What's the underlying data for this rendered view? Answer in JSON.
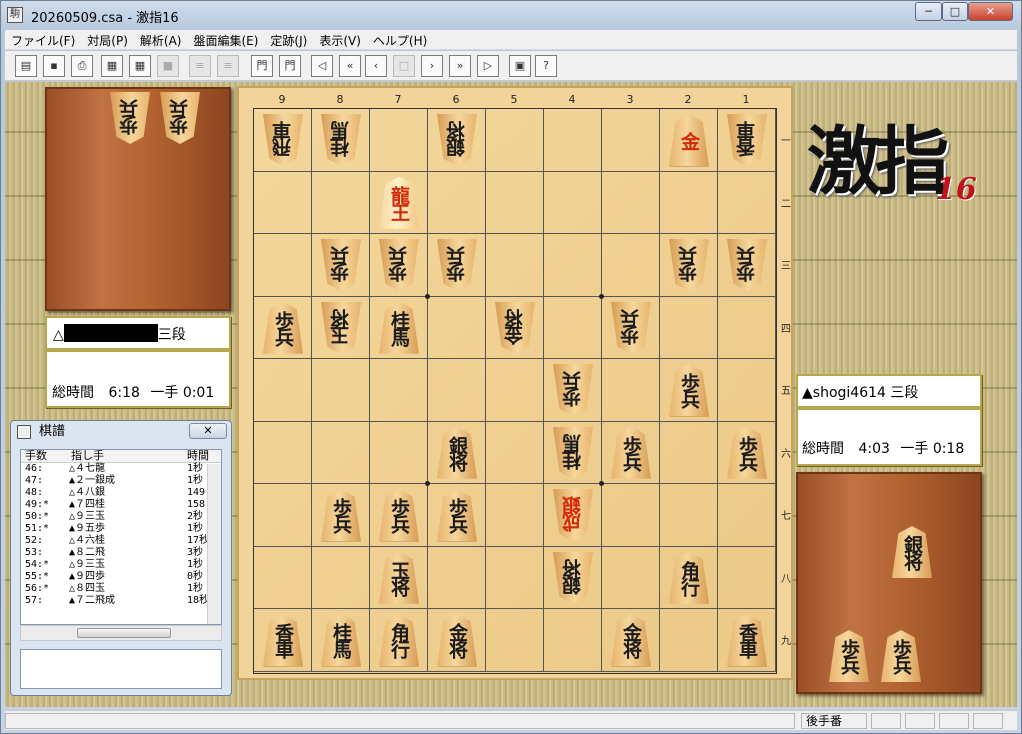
{
  "window": {
    "title": "20260509.csa - 激指16",
    "minimize": "─",
    "maximize": "□",
    "close": "✕"
  },
  "menu": [
    "ファイル(F)",
    "対局(P)",
    "解析(A)",
    "盤面編集(E)",
    "定跡(J)",
    "表示(V)",
    "ヘルプ(H)"
  ],
  "toolbar": [
    {
      "name": "new-icon",
      "glyph": "▤",
      "enabled": true
    },
    {
      "name": "save-icon",
      "glyph": "▪",
      "enabled": true
    },
    {
      "name": "print-icon",
      "glyph": "⎙",
      "enabled": true
    },
    {
      "name": "book-icon",
      "glyph": "▦",
      "enabled": true
    },
    {
      "name": "book2-icon",
      "glyph": "▦",
      "enabled": true
    },
    {
      "name": "blank-icon",
      "glyph": "■",
      "enabled": false
    },
    {
      "name": "list-icon",
      "glyph": "≡",
      "enabled": false
    },
    {
      "name": "list2-icon",
      "glyph": "≡",
      "enabled": false
    },
    {
      "name": "board-icon",
      "glyph": "門",
      "enabled": true
    },
    {
      "name": "board2-icon",
      "glyph": "門",
      "enabled": true
    },
    {
      "name": "first-move-icon",
      "glyph": "◁",
      "enabled": true
    },
    {
      "name": "back10-icon",
      "glyph": "«",
      "enabled": true
    },
    {
      "name": "back-icon",
      "glyph": "‹",
      "enabled": true
    },
    {
      "name": "stop-icon",
      "glyph": "□",
      "enabled": false
    },
    {
      "name": "forward-icon",
      "glyph": "›",
      "enabled": true
    },
    {
      "name": "forward10-icon",
      "glyph": "»",
      "enabled": true
    },
    {
      "name": "last-move-icon",
      "glyph": "▷",
      "enabled": true
    },
    {
      "name": "monitor-icon",
      "glyph": "▣",
      "enabled": true
    },
    {
      "name": "help-icon",
      "glyph": "?",
      "enabled": true
    }
  ],
  "board": {
    "files": [
      "9",
      "8",
      "7",
      "6",
      "5",
      "4",
      "3",
      "2",
      "1"
    ],
    "ranks": [
      "一",
      "二",
      "三",
      "四",
      "五",
      "六",
      "七",
      "八",
      "九"
    ],
    "pieces": [
      {
        "file": 9,
        "rank": 1,
        "label": "飛車",
        "side": "gote"
      },
      {
        "file": 8,
        "rank": 1,
        "label": "桂馬",
        "side": "gote"
      },
      {
        "file": 6,
        "rank": 1,
        "label": "銀将",
        "side": "gote"
      },
      {
        "file": 2,
        "rank": 1,
        "label": "金",
        "side": "sente",
        "promoted": true
      },
      {
        "file": 1,
        "rank": 1,
        "label": "香車",
        "side": "gote"
      },
      {
        "file": 7,
        "rank": 2,
        "label": "龍王",
        "side": "sente",
        "promoted": true,
        "last": true
      },
      {
        "file": 8,
        "rank": 3,
        "label": "歩兵",
        "side": "gote"
      },
      {
        "file": 7,
        "rank": 3,
        "label": "歩兵",
        "side": "gote"
      },
      {
        "file": 6,
        "rank": 3,
        "label": "歩兵",
        "side": "gote"
      },
      {
        "file": 2,
        "rank": 3,
        "label": "歩兵",
        "side": "gote"
      },
      {
        "file": 1,
        "rank": 3,
        "label": "歩兵",
        "side": "gote"
      },
      {
        "file": 9,
        "rank": 4,
        "label": "歩兵",
        "side": "sente"
      },
      {
        "file": 8,
        "rank": 4,
        "label": "玉将",
        "side": "gote"
      },
      {
        "file": 7,
        "rank": 4,
        "label": "桂馬",
        "side": "sente"
      },
      {
        "file": 5,
        "rank": 4,
        "label": "金将",
        "side": "gote"
      },
      {
        "file": 3,
        "rank": 4,
        "label": "歩兵",
        "side": "gote"
      },
      {
        "file": 4,
        "rank": 5,
        "label": "歩兵",
        "side": "gote"
      },
      {
        "file": 2,
        "rank": 5,
        "label": "歩兵",
        "side": "sente"
      },
      {
        "file": 6,
        "rank": 6,
        "label": "銀将",
        "side": "sente"
      },
      {
        "file": 4,
        "rank": 6,
        "label": "桂馬",
        "side": "gote"
      },
      {
        "file": 3,
        "rank": 6,
        "label": "歩兵",
        "side": "sente"
      },
      {
        "file": 1,
        "rank": 6,
        "label": "歩兵",
        "side": "sente"
      },
      {
        "file": 8,
        "rank": 7,
        "label": "歩兵",
        "side": "sente"
      },
      {
        "file": 7,
        "rank": 7,
        "label": "歩兵",
        "side": "sente"
      },
      {
        "file": 6,
        "rank": 7,
        "label": "歩兵",
        "side": "sente"
      },
      {
        "file": 4,
        "rank": 7,
        "label": "成銀",
        "side": "gote",
        "promoted": true
      },
      {
        "file": 7,
        "rank": 8,
        "label": "玉将",
        "side": "sente"
      },
      {
        "file": 4,
        "rank": 8,
        "label": "銀将",
        "side": "gote"
      },
      {
        "file": 2,
        "rank": 8,
        "label": "角行",
        "side": "sente"
      },
      {
        "file": 9,
        "rank": 9,
        "label": "香車",
        "side": "sente"
      },
      {
        "file": 8,
        "rank": 9,
        "label": "桂馬",
        "side": "sente"
      },
      {
        "file": 7,
        "rank": 9,
        "label": "角行",
        "side": "sente"
      },
      {
        "file": 6,
        "rank": 9,
        "label": "金将",
        "side": "sente"
      },
      {
        "file": 3,
        "rank": 9,
        "label": "金将",
        "side": "sente"
      },
      {
        "file": 1,
        "rank": 9,
        "label": "香車",
        "side": "sente"
      }
    ]
  },
  "gote_hand": [
    "歩兵",
    "歩兵"
  ],
  "sente_hand": [
    "銀将",
    "歩兵",
    "歩兵"
  ],
  "gote_player": {
    "mark": "△",
    "rank": "三段",
    "total_time_label": "総時間",
    "total_time": "6:18",
    "per_move_label": "一手",
    "per_move": "0:01"
  },
  "sente_player": {
    "mark": "▲",
    "name": "shogi4614",
    "rank": "三段",
    "total_time_label": "総時間",
    "total_time": "4:03",
    "per_move_label": "一手",
    "per_move": "0:18"
  },
  "logo": {
    "text": "激指",
    "version": "16"
  },
  "kifu": {
    "title": "棋譜",
    "close": "✕",
    "headers": [
      "手数",
      "指し手",
      "時間"
    ],
    "rows": [
      {
        "no": "46:",
        "move": "△４七龍",
        "time": "1秒"
      },
      {
        "no": "47:",
        "move": "▲２一銀成",
        "time": "1秒"
      },
      {
        "no": "48:",
        "move": "△４八銀",
        "time": "149"
      },
      {
        "no": "49:*",
        "move": "▲７四桂",
        "time": "158"
      },
      {
        "no": "50:*",
        "move": "△９三玉",
        "time": "2秒"
      },
      {
        "no": "51:*",
        "move": "▲９五歩",
        "time": "1秒"
      },
      {
        "no": "52:",
        "move": "△４六桂",
        "time": "17秒"
      },
      {
        "no": "53:",
        "move": "▲８二飛",
        "time": "3秒"
      },
      {
        "no": "54:*",
        "move": "△９三玉",
        "time": "1秒"
      },
      {
        "no": "55:*",
        "move": "▲９四歩",
        "time": "0秒"
      },
      {
        "no": "56:*",
        "move": "△８四玉",
        "time": "1秒"
      },
      {
        "no": "57:",
        "move": "▲７二飛成",
        "time": "18秒"
      }
    ]
  },
  "status": {
    "turn": "後手番"
  }
}
